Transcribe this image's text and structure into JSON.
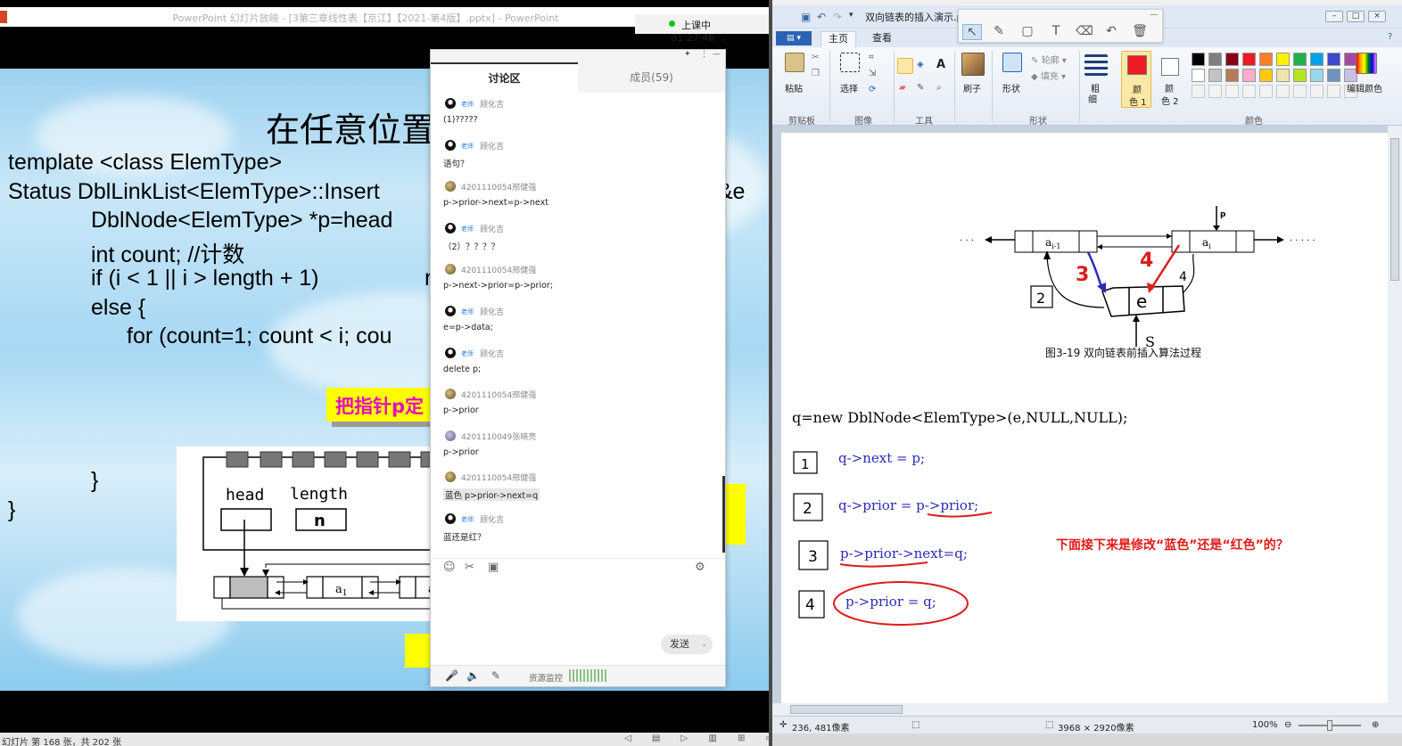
{
  "ppt": {
    "title": "PowerPoint 幻灯片放映 - [3第三章线性表【京江】【2021-第4版】.pptx] - PowerPoint",
    "timer": "上课中 01:27:46",
    "slide_title": "在任意位置",
    "code_lines": [
      "template <class ElemType>",
      "Status DblLinkList<ElemType>::Insert",
      "DblNode<ElemType> *p=head",
      "int count; //计数",
      "if (i < 1 || i > length + 1)",
      "else     {",
      "for (count=1; count < i; cou",
      "}",
      "}"
    ],
    "code_tail_1": "e &e",
    "code_tail_2": "r",
    "yellow_note": "把指针p定",
    "struct_head": "head",
    "struct_length": "length",
    "struct_n": "n",
    "struct_a1": "a",
    "struct_a1_sub": "1",
    "struct_a_trail": "a",
    "status": "幻灯片 第 168 张，共 202 张",
    "status_ctrls": "◁ ▤ ▷  ▥ ⊞ ▭"
  },
  "chat": {
    "tabs": {
      "discuss": "讨论区",
      "members": "成员(59)"
    },
    "role_teacher": "老师",
    "messages": [
      {
        "name": "顾化吉",
        "teacher": true,
        "text": "(1)?????",
        "avatar": "penguin"
      },
      {
        "name": "顾化吉",
        "teacher": true,
        "text": "语句？",
        "avatar": "penguin"
      },
      {
        "name": "4201110054邢健强",
        "teacher": false,
        "text": "p->prior->next=p->next",
        "avatar": "photo"
      },
      {
        "name": "顾化吉",
        "teacher": true,
        "text": "（2）？？？？",
        "avatar": "penguin"
      },
      {
        "name": "4201110054邢健强",
        "teacher": false,
        "text": "p->next->prior=p->prior;",
        "avatar": "photo"
      },
      {
        "name": "顾化吉",
        "teacher": true,
        "text": "e=p->data;",
        "avatar": "penguin"
      },
      {
        "name": "顾化吉",
        "teacher": true,
        "text": "delete p;",
        "avatar": "penguin"
      },
      {
        "name": "4201110054邢健强",
        "teacher": false,
        "text": "p->prior",
        "avatar": "photo"
      },
      {
        "name": "4201110049张晓亮",
        "teacher": false,
        "text": "p->prior",
        "avatar": "photo2"
      },
      {
        "name": "4201110054邢健强",
        "teacher": false,
        "text": "蓝色 p>prior->next=q",
        "avatar": "photo",
        "highlight": true
      },
      {
        "name": "顾化吉",
        "teacher": true,
        "text": "蓝还是红？",
        "avatar": "penguin"
      }
    ],
    "send": "发送",
    "monitor": "资源监控",
    "tools": {
      "emoji": "☺",
      "scissors": "✂",
      "image": "▣",
      "settings": "⚙"
    },
    "bottom_icons": {
      "mic": "🎤",
      "speaker": "🔈",
      "pen": "✎"
    },
    "topbar_icons": {
      "pin": "✦",
      "more": "⋮",
      "minimize": "—"
    }
  },
  "paint": {
    "title": "双向链表的插入演示.p",
    "tabs": {
      "home": "主页",
      "view": "查看"
    },
    "file_menu": "▤ ▾",
    "groups": {
      "clipboard": "剪贴板",
      "image": "图像",
      "tools": "工具",
      "shapes": "形状",
      "colors": "颜色"
    },
    "buttons": {
      "paste": "粘贴",
      "select": "选择",
      "brush": "刷子",
      "shape": "形状",
      "outline": "轮廓",
      "fill": "填充",
      "thickness_1": "粗",
      "thickness_2": "细",
      "color1_a": "颜",
      "color1_b": "色 1",
      "color2_a": "颜",
      "color2_b": "色 2",
      "edit_colors": "编辑颜色"
    },
    "palette": [
      "#000000",
      "#7f7f7f",
      "#880015",
      "#ed1c24",
      "#ff7f27",
      "#fff200",
      "#22b14c",
      "#00a2e8",
      "#3f48cc",
      "#a349a4",
      "#ffffff",
      "#c3c3c3",
      "#b97a57",
      "#ffaec9",
      "#ffc90e",
      "#efe4b0",
      "#b5e61d",
      "#99d9ea",
      "#7092be",
      "#c8bfe7"
    ],
    "canvas": {
      "node_left": "a",
      "node_left_sub": "i-1",
      "node_right": "a",
      "node_right_sub": "i",
      "p_label": "p",
      "e_label": "e",
      "s_label": "S",
      "dots_left": "· · ·",
      "dots_right": "· · · · ·",
      "caption": "图3-19    双向链表前插入算法过程",
      "new_line": "q=new DblNode<ElemType>(e,NULL,NULL);",
      "step1": "q->next  =  p;",
      "step2_a": "q->prior = ",
      "step2_b": "p->prior",
      "step2_c": ";",
      "step3": "p->prior->next=q;",
      "step4": "p->prior = q;",
      "note": "下面接下来是修改“蓝色”还是“红色”的？",
      "hand_1": "1",
      "hand_2": "2",
      "hand_3": "3",
      "hand_4": "4",
      "hand_2b": "2",
      "hand_3b": "3",
      "hand_4b": "4"
    },
    "status": {
      "coords": "236, 481像素",
      "size": "3968 × 2920像素",
      "zoom": "100%"
    }
  }
}
